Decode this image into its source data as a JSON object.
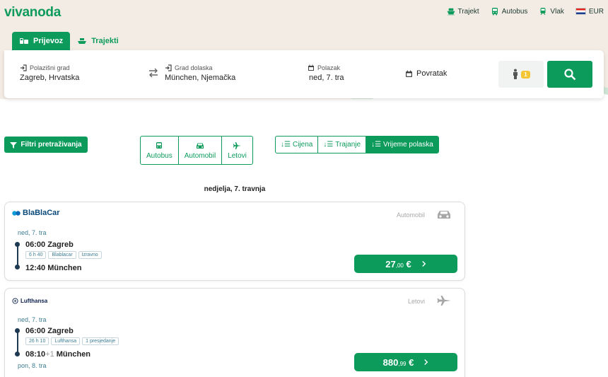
{
  "brand": {
    "logo": "vivanoda",
    "accent": "#0d9b5c"
  },
  "topnav": {
    "ferry": "Trajekt",
    "bus": "Autobus",
    "train": "Vlak",
    "currency": "EUR"
  },
  "tabs": {
    "transport": "Prijevoz",
    "ferries": "Trajekti"
  },
  "search": {
    "from_label": "Polazišni grad",
    "from_value": "Zagreb, Hrvatska",
    "to_label": "Grad dolaska",
    "to_value": "München, Njemačka",
    "depart_label": "Polazak",
    "depart_value": "ned, 7. tra",
    "return_label": "Povratak",
    "passengers": "1"
  },
  "filters": {
    "filter_button": "Filtri pretraživanja",
    "modes": {
      "bus": "Autobus",
      "car": "Automobil",
      "flights": "Letovi"
    },
    "sorts": {
      "price": "Cijena",
      "duration": "Trajanje",
      "departure": "Vrijeme polaska"
    }
  },
  "results": {
    "date_heading": "nedjelja, 7. travnja",
    "card1": {
      "operator": "BlaBlaCar",
      "type": "Automobil",
      "date": "ned, 7. tra",
      "dep": "06:00 Zagreb",
      "tags": [
        "6 h 40",
        "Blablacar",
        "Izravno"
      ],
      "arr": "12:40 München",
      "price_main": "27",
      "price_cents": ",00",
      "price_cur": "€"
    },
    "card2": {
      "operator": "Lufthansa",
      "type": "Letovi",
      "date": "ned, 7. tra",
      "dep": "06:00 Zagreb",
      "tags": [
        "26 h 10",
        "Lufthansa",
        "1 presjedanje"
      ],
      "arr_time": "08:10",
      "arr_plus": "+1",
      "arr_city": "München",
      "arr_date": "pon, 8. tra",
      "price_main": "880",
      "price_cents": ",99",
      "price_cur": "€"
    }
  }
}
